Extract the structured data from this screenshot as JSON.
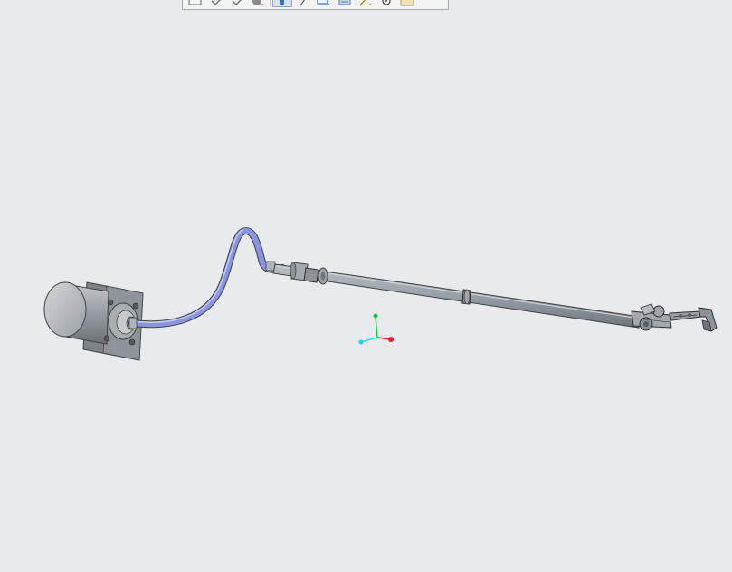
{
  "viewport": {
    "background": "#e8eaee"
  },
  "toolbar": {
    "buttons": [
      {
        "icon": "rectangle-select-icon",
        "active": false
      },
      {
        "icon": "checkmark-icon",
        "active": false
      },
      {
        "icon": "checkmark-icon",
        "active": false
      },
      {
        "icon": "sphere-display-icon",
        "active": false
      },
      {
        "icon": "shaded-view-icon",
        "active": true
      },
      {
        "icon": "line-sketch-icon",
        "active": false
      },
      {
        "icon": "box-view-icon",
        "active": false
      },
      {
        "icon": "section-view-icon",
        "active": false
      },
      {
        "icon": "magic-wand-icon",
        "active": false
      },
      {
        "icon": "info-icon",
        "active": false
      },
      {
        "icon": "folder-icon",
        "active": false
      }
    ]
  },
  "model": {
    "colors": {
      "motor": "#a8adb3",
      "hose": "#8a94e0",
      "shaft": "#9ea6ad",
      "outline": "#3e4246"
    }
  },
  "triad": {
    "colors": {
      "x_axis": "#e02020",
      "y_axis": "#20c040",
      "z_axis": "#20d0e0"
    }
  }
}
